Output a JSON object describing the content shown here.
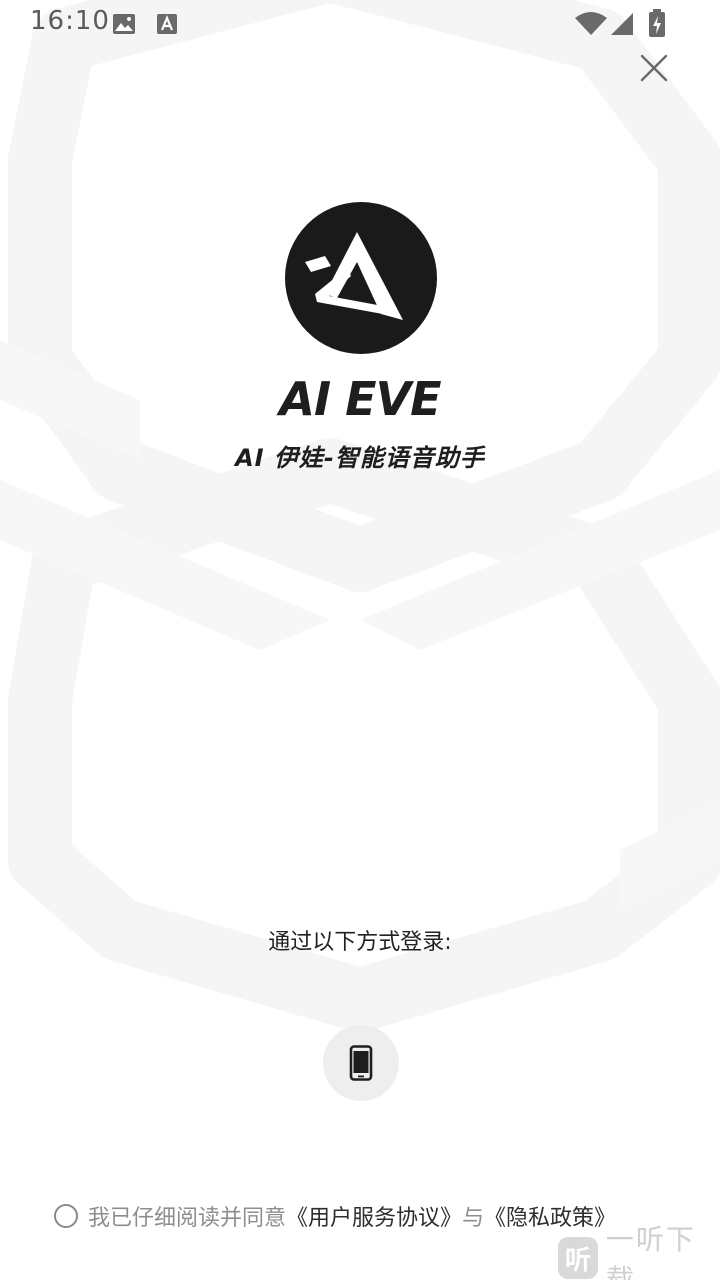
{
  "status_bar": {
    "time": "16:10",
    "icons": [
      "gallery-notification-icon",
      "font-notification-icon",
      "wifi-icon",
      "cell-signal-icon",
      "battery-charging-icon"
    ]
  },
  "header": {
    "close_icon": "close-icon"
  },
  "brand": {
    "logo_icon": "ai-eve-logo-icon",
    "title": "AI EVE",
    "subtitle": "AI 伊娃-智能语音助手"
  },
  "login": {
    "prompt": "通过以下方式登录:",
    "phone_icon": "smartphone-icon"
  },
  "agreement": {
    "checked": false,
    "text_prefix": "我已仔细阅读并同意",
    "user_agreement": "《用户服务协议》",
    "conjunction": "与",
    "privacy_policy": "《隐私政策》"
  },
  "watermark": {
    "badge": "听",
    "text": "一听下载"
  },
  "colors": {
    "background": "#ffffff",
    "pattern": "#f6f6f6",
    "logo": "#1a1a1a",
    "text_dark": "#222222",
    "text_muted": "#8e8e8e"
  }
}
